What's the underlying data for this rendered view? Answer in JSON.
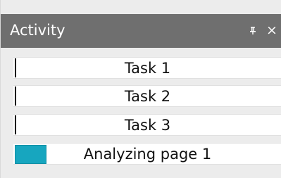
{
  "panel": {
    "title": "Activity",
    "pin_glyph": "⊥",
    "close_glyph": "×",
    "icons": {
      "pin": "pin-icon",
      "close": "close-icon"
    }
  },
  "tasks": [
    {
      "label": "Task 1",
      "progress": 0.0
    },
    {
      "label": "Task 2",
      "progress": 0.0
    },
    {
      "label": "Task 3",
      "progress": 0.0
    },
    {
      "label": "Analyzing page 1",
      "progress": 0.12
    }
  ],
  "colors": {
    "titlebar": "#6f6f6f",
    "panel_bg": "#ececec",
    "progress_fill": "#17a6bf"
  }
}
